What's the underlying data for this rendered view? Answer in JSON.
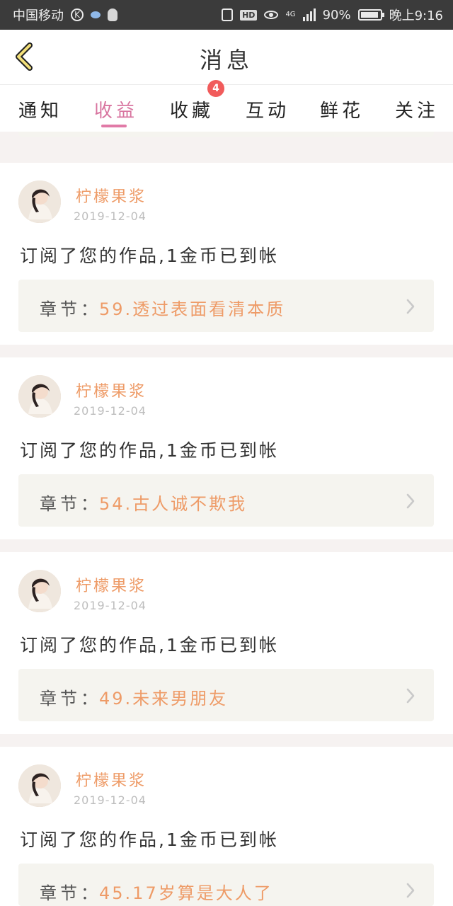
{
  "status_bar": {
    "carrier": "中国移动",
    "k_label": "K",
    "hd_label": "HD",
    "network_label": "4G",
    "battery_percent": "90%",
    "time": "晚上9:16"
  },
  "header": {
    "title": "消息",
    "back_icon": "back-chevron-icon"
  },
  "tabs": {
    "notice": "通知",
    "income": "收益",
    "favorite": "收藏",
    "interaction": "互动",
    "flower": "鲜花",
    "follow": "关注",
    "badge_count": "4"
  },
  "items": [
    {
      "author": "柠檬果浆",
      "date": "2019-12-04",
      "message": "订阅了您的作品,1金币已到帐",
      "chapter_label": "章节：",
      "chapter_title": "59.透过表面看清本质"
    },
    {
      "author": "柠檬果浆",
      "date": "2019-12-04",
      "message": "订阅了您的作品,1金币已到帐",
      "chapter_label": "章节：",
      "chapter_title": "54.古人诚不欺我"
    },
    {
      "author": "柠檬果浆",
      "date": "2019-12-04",
      "message": "订阅了您的作品,1金币已到帐",
      "chapter_label": "章节：",
      "chapter_title": "49.未来男朋友"
    },
    {
      "author": "柠檬果浆",
      "date": "2019-12-04",
      "message": "订阅了您的作品,1金币已到帐",
      "chapter_label": "章节：",
      "chapter_title": "45.17岁算是大人了"
    }
  ],
  "colors": {
    "accent_pink": "#d8749f",
    "accent_orange": "#ee9b67",
    "badge_red": "#f15b5b",
    "background": "#f6f2f1"
  }
}
